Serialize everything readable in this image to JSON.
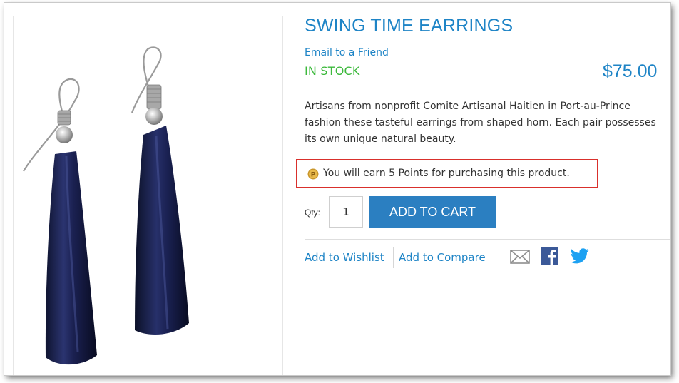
{
  "product": {
    "title": "SWING TIME EARRINGS",
    "email_link": "Email to a Friend",
    "stock_status": "IN STOCK",
    "price": "$75.00",
    "description": "Artisans from nonprofit Comite Artisanal Haitien in Port-au-Prince fashion these tasteful earrings from shaped horn. Each pair possesses its own unique natural beauty.",
    "points_message": "You will earn 5 Points for purchasing this product.",
    "image_icon": "earrings-product-image"
  },
  "purchase": {
    "qty_label": "Qty:",
    "qty_value": "1",
    "add_to_cart_label": "ADD TO CART"
  },
  "actions": {
    "wishlist_label": "Add to Wishlist",
    "compare_label": "Add to Compare",
    "share_icons": [
      "mail-icon",
      "facebook-icon",
      "twitter-icon"
    ]
  },
  "colors": {
    "link_blue": "#1e84c6",
    "in_stock_green": "#3cb93c",
    "button_blue": "#2b7fc1",
    "highlight_red": "#d9302c",
    "facebook_blue": "#3b5998",
    "twitter_blue": "#1da1f2"
  }
}
